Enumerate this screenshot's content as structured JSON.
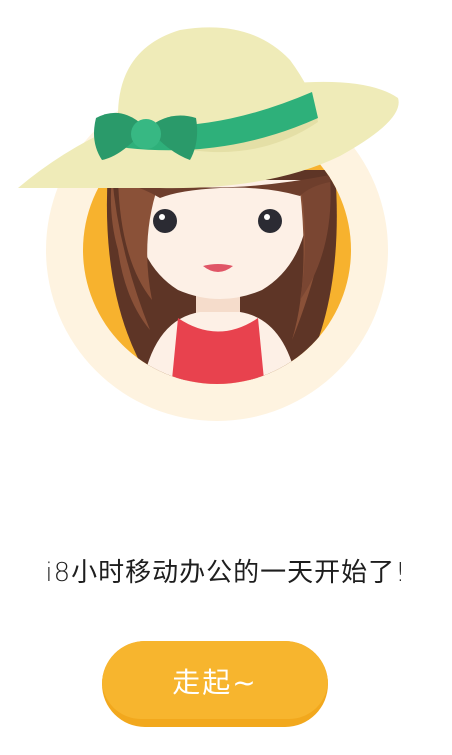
{
  "illustration": {
    "subject": "girl-in-sun-hat-avatar",
    "colors": {
      "halo": "#FEF3E0",
      "ring": "#F7B22E",
      "hat": "#EFEBB8",
      "ribbon": "#2EB07A",
      "bow": "#2A9A6A",
      "hair": "#6E3E2C",
      "skin": "#FDF0E6",
      "dress": "#E8424E",
      "lips": "#E05566"
    }
  },
  "welcome": {
    "tagline": "i8小时移动办公的一天开始了!"
  },
  "actions": {
    "start_label": "走起~",
    "start_color": "#F7B52E"
  }
}
